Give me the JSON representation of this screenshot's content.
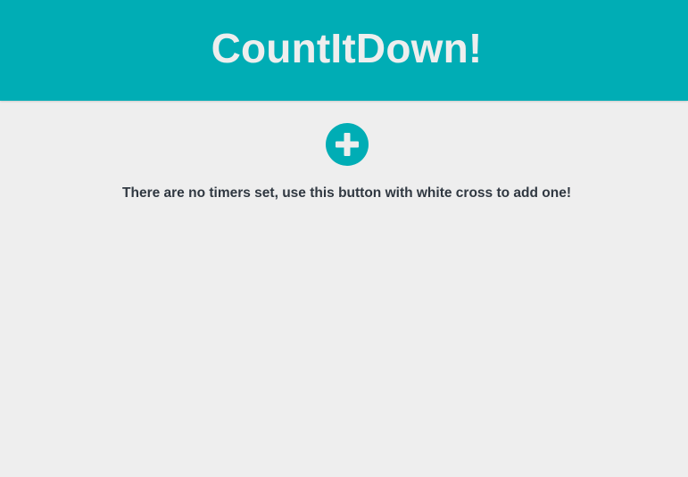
{
  "header": {
    "title": "CountItDown!"
  },
  "main": {
    "add_button_icon": "plus-icon",
    "empty_message": "There are no timers set, use this button with white cross to add one!"
  },
  "colors": {
    "accent": "#00adb5",
    "background": "#eeeeee",
    "title_text": "#eeeeee",
    "body_text": "#303841"
  }
}
